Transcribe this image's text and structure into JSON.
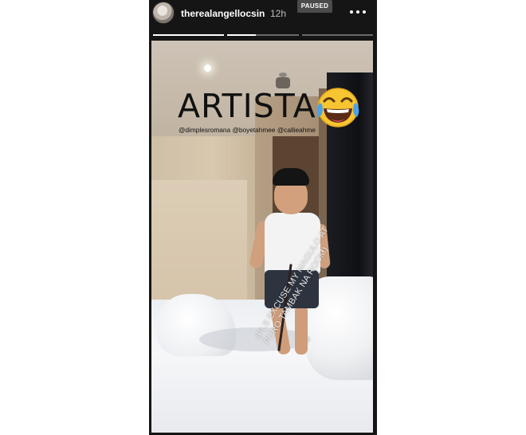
{
  "story": {
    "username": "therealangellocsin",
    "timestamp": "12h",
    "status_badge": "PAUSED",
    "progress_segments": [
      1,
      0.4,
      0
    ],
    "overlay_text": "ARTISTA",
    "emoji": "face-with-tears-of-joy",
    "mentions": "@dimplesromana @boyetahmee @callieahme",
    "caption_lines": [
      "(PLS EXCUSE MY MAGULO AT",
      "PURO TAMBAK NA ROOM)"
    ]
  },
  "colors": {
    "frame": "#151515",
    "badge": "#4b4b4b",
    "progress_active": "#ffffff",
    "progress_inactive": "#6a6a6a"
  }
}
